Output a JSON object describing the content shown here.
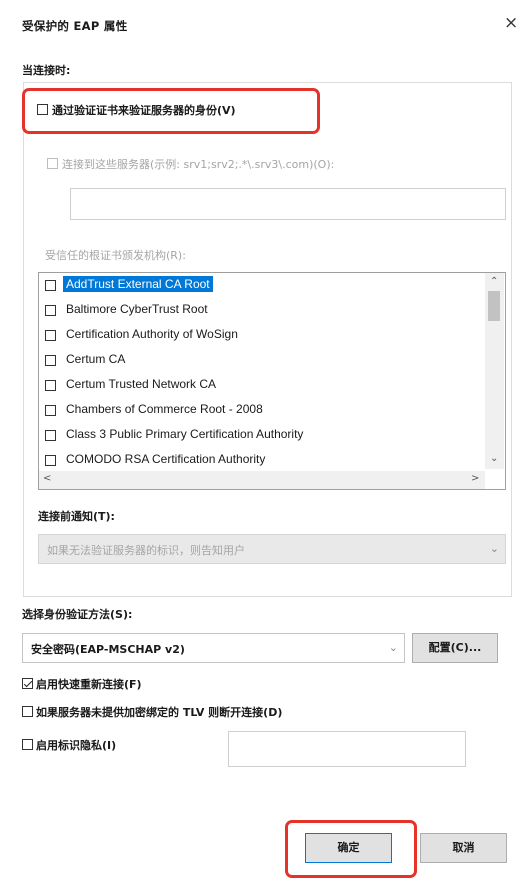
{
  "dialog": {
    "title": "受保护的 EAP 属性",
    "close_glyph": "×"
  },
  "connect": {
    "label": "当连接时:",
    "verify_cert_label": "通过验证证书来验证服务器的身份(V)",
    "connect_servers_label": "连接到这些服务器(示例: srv1;srv2;.*\\.srv3\\.com)(O):",
    "servers_value": "",
    "trusted_ca_label": "受信任的根证书颁发机构(R):",
    "ca_list": [
      {
        "name": "AddTrust External CA Root",
        "selected": true
      },
      {
        "name": "Baltimore CyberTrust Root",
        "selected": false
      },
      {
        "name": "Certification Authority of WoSign",
        "selected": false
      },
      {
        "name": "Certum CA",
        "selected": false
      },
      {
        "name": "Certum Trusted Network CA",
        "selected": false
      },
      {
        "name": "Chambers of Commerce Root - 2008",
        "selected": false
      },
      {
        "name": "Class 3 Public Primary Certification Authority",
        "selected": false
      },
      {
        "name": "COMODO RSA Certification Authority",
        "selected": false
      }
    ],
    "notify_label": "连接前通知(T):",
    "notify_value": "如果无法验证服务器的标识，则告知用户"
  },
  "auth": {
    "method_label": "选择身份验证方法(S):",
    "method_value": "安全密码(EAP-MSCHAP v2)",
    "configure_label": "配置(C)...",
    "fast_reconnect_label": "启用快速重新连接(F)",
    "disconnect_tlv_label": "如果服务器未提供加密绑定的 TLV 则断开连接(D)",
    "identity_privacy_label": "启用标识隐私(I)",
    "identity_value": ""
  },
  "buttons": {
    "ok_label": "确定",
    "cancel_label": "取消"
  },
  "colors": {
    "highlight_red": "#e5332a",
    "selection_blue": "#0078d7"
  }
}
